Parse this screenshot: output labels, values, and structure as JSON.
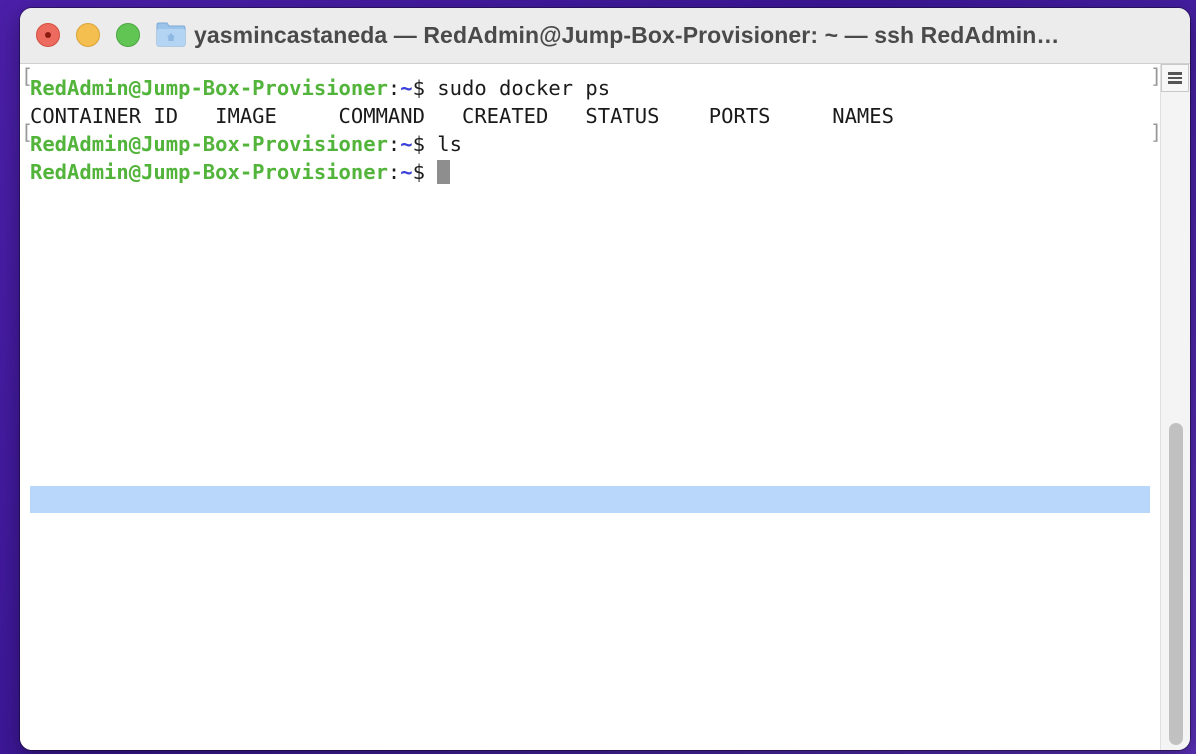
{
  "window": {
    "title": "yasmincastaneda — RedAdmin@Jump-Box-Provisioner: ~ — ssh RedAdmin…"
  },
  "terminal": {
    "lines": [
      {
        "user": "RedAdmin@Jump-Box-Provisioner",
        "sep": ":",
        "cwd": "~",
        "prompt": "$ ",
        "command": "sudo docker ps"
      },
      {
        "output": "CONTAINER ID   IMAGE     COMMAND   CREATED   STATUS    PORTS     NAMES"
      },
      {
        "user": "RedAdmin@Jump-Box-Provisioner",
        "sep": ":",
        "cwd": "~",
        "prompt": "$ ",
        "command": "ls"
      },
      {
        "user": "RedAdmin@Jump-Box-Provisioner",
        "sep": ":",
        "cwd": "~",
        "prompt": "$ ",
        "command": ""
      }
    ]
  },
  "colors": {
    "prompt_user": "#52b43a",
    "prompt_cwd": "#3a3fd8",
    "selection": "#b8d7fb"
  },
  "icons": [
    "close-button",
    "minimize-button",
    "zoom-button",
    "folder-icon",
    "split-pane-icon"
  ]
}
